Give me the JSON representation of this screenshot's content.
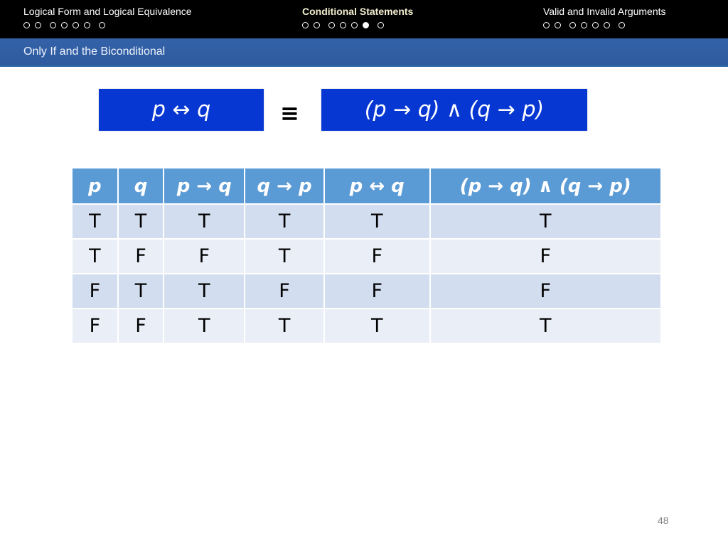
{
  "navigation": {
    "sections": [
      {
        "title": "Logical Form and Logical Equivalence",
        "active": false,
        "slides": 7,
        "current": null
      },
      {
        "title": "Conditional Statements",
        "active": true,
        "slides": 7,
        "current": 6
      },
      {
        "title": "Valid and Invalid Arguments",
        "active": false,
        "slides": 7,
        "current": null
      }
    ]
  },
  "header": {
    "subtitle": "Only If and the Biconditional"
  },
  "equivalence": {
    "left": "p ↔ q",
    "symbol": "≡",
    "right": "(p → q) ∧ (q → p)"
  },
  "truth_table": {
    "headers": [
      "p",
      "q",
      "p → q",
      "q → p",
      "p ↔ q",
      "(p → q) ∧ (q → p)"
    ],
    "rows": [
      [
        "T",
        "T",
        "T",
        "T",
        "T",
        "T"
      ],
      [
        "T",
        "F",
        "F",
        "T",
        "F",
        "F"
      ],
      [
        "F",
        "T",
        "T",
        "F",
        "F",
        "F"
      ],
      [
        "F",
        "F",
        "T",
        "T",
        "T",
        "T"
      ]
    ]
  },
  "footer": {
    "page_number": "48"
  },
  "colors": {
    "formula_box": "#0737d3",
    "table_header": "#5b9bd5",
    "row_odd": "#d2deef",
    "row_even": "#eaeff7",
    "active_section": "#f2efcf"
  }
}
